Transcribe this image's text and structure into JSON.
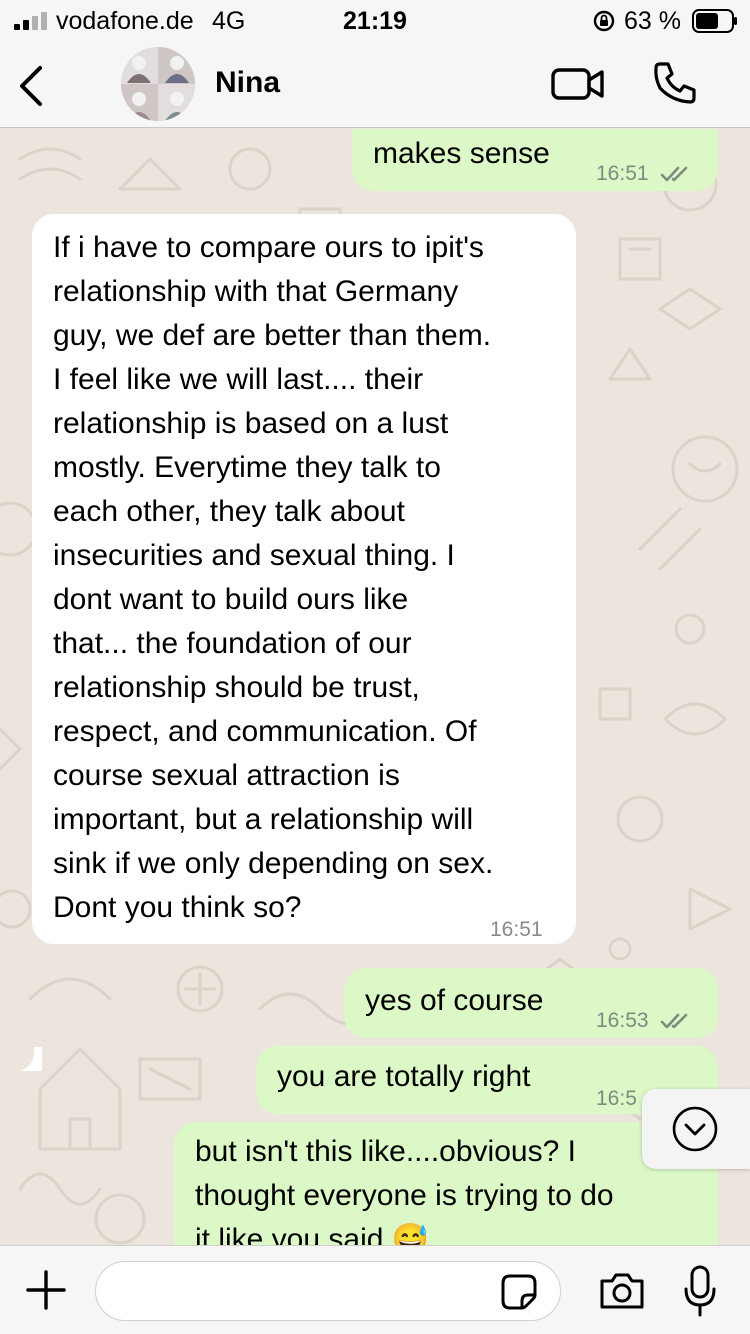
{
  "status_bar": {
    "carrier": "vodafone.de",
    "network": "4G",
    "time": "21:19",
    "battery": "63 %"
  },
  "header": {
    "contact_name": "Nina"
  },
  "messages": [
    {
      "direction": "outgoing",
      "text": "makes sense",
      "time": "16:51",
      "status": "read"
    },
    {
      "direction": "incoming",
      "lines": [
        "If i have to compare ours to ipit's",
        "relationship with that Germany",
        "guy, we def are better than them.",
        "I feel like we will last.... their",
        "relationship is based on a lust",
        "mostly. Everytime they talk to",
        "each other, they talk about",
        "insecurities and sexual thing. I",
        "dont want to build ours like",
        "that... the foundation of our",
        "relationship should be trust,",
        "respect, and communication. Of",
        "course sexual attraction is",
        "important, but a relationship will",
        "sink if we only depending on sex.",
        "Dont you think so?"
      ],
      "time": "16:51"
    },
    {
      "direction": "outgoing",
      "text": "yes of course",
      "time": "16:53",
      "status": "read"
    },
    {
      "direction": "outgoing",
      "text": "you are totally right",
      "time": "16:5",
      "status": "read"
    },
    {
      "direction": "outgoing",
      "lines": [
        "but isn't this like....obvious? I",
        "thought everyone is trying to do",
        "it like you said 😅"
      ]
    }
  ],
  "input": {
    "placeholder": ""
  },
  "colors": {
    "outgoing_bubble": "#dcf8c6",
    "incoming_bubble": "#ffffff",
    "wallpaper": "#ece5dd",
    "read_ticks": "#7f8a80"
  }
}
